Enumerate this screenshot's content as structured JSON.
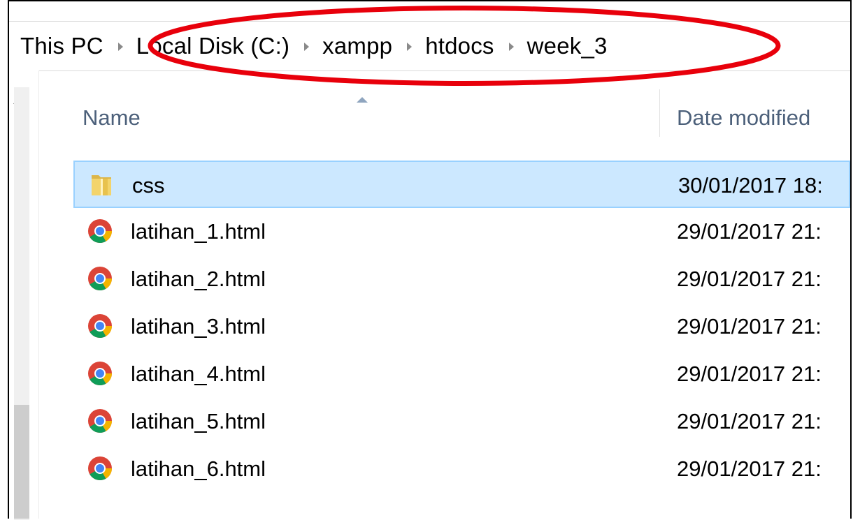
{
  "breadcrumb": {
    "items": [
      "This PC",
      "Local Disk (C:)",
      "xampp",
      "htdocs",
      "week_3"
    ]
  },
  "columns": {
    "name_label": "Name",
    "date_label": "Date modified"
  },
  "files": [
    {
      "name": "css",
      "date": "30/01/2017 18:",
      "type": "folder",
      "selected": true
    },
    {
      "name": "latihan_1.html",
      "date": "29/01/2017 21:",
      "type": "chrome-html"
    },
    {
      "name": "latihan_2.html",
      "date": "29/01/2017 21:",
      "type": "chrome-html"
    },
    {
      "name": "latihan_3.html",
      "date": "29/01/2017 21:",
      "type": "chrome-html"
    },
    {
      "name": "latihan_4.html",
      "date": "29/01/2017 21:",
      "type": "chrome-html"
    },
    {
      "name": "latihan_5.html",
      "date": "29/01/2017 21:",
      "type": "chrome-html"
    },
    {
      "name": "latihan_6.html",
      "date": "29/01/2017 21:",
      "type": "chrome-html"
    }
  ],
  "colors": {
    "selection_bg": "#cce8ff",
    "selection_border": "#99d1ff",
    "annotation": "#e8000b",
    "header_text": "#4c607a"
  },
  "icons": {
    "folder": "folder-icon",
    "chrome-html": "chrome-html-file-icon"
  }
}
